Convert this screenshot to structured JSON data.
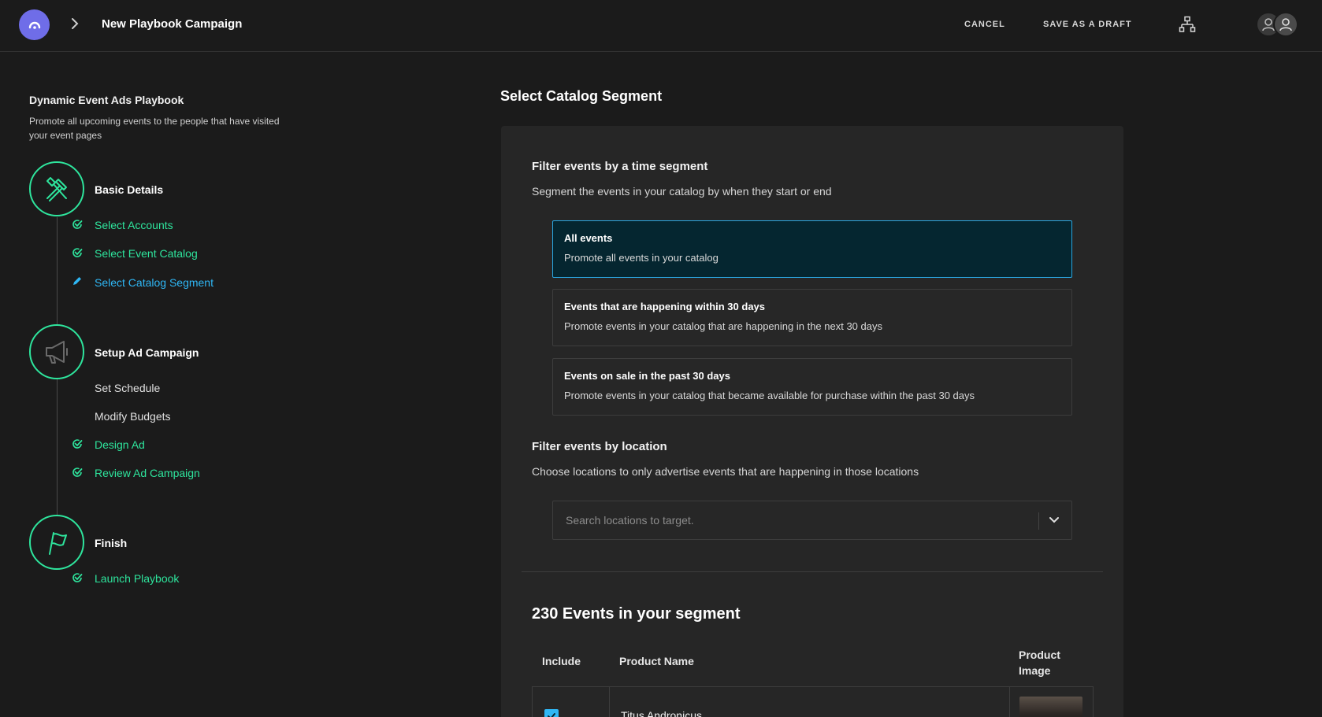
{
  "header": {
    "title": "New Playbook Campaign",
    "cancel_label": "CANCEL",
    "draft_label": "SAVE AS A DRAFT"
  },
  "sidebar": {
    "playbook_title": "Dynamic Event Ads Playbook",
    "playbook_desc": "Promote all upcoming events to the people that have visited your event pages",
    "steps": [
      {
        "title": "Basic Details",
        "items": [
          {
            "label": "Select Accounts",
            "state": "done"
          },
          {
            "label": "Select Event Catalog",
            "state": "done"
          },
          {
            "label": "Select Catalog Segment",
            "state": "active"
          }
        ]
      },
      {
        "title": "Setup Ad Campaign",
        "items": [
          {
            "label": "Set Schedule",
            "state": "todo"
          },
          {
            "label": "Modify Budgets",
            "state": "todo"
          },
          {
            "label": "Design Ad",
            "state": "done"
          },
          {
            "label": "Review Ad Campaign",
            "state": "done"
          }
        ]
      },
      {
        "title": "Finish",
        "items": [
          {
            "label": "Launch Playbook",
            "state": "done"
          }
        ]
      }
    ]
  },
  "main": {
    "section_title": "Select Catalog Segment",
    "time_filter": {
      "title": "Filter events by a time segment",
      "desc": "Segment the events in your catalog by when they start or end",
      "options": [
        {
          "title": "All events",
          "desc": "Promote all events in your catalog",
          "selected": true
        },
        {
          "title": "Events that are happening within 30 days",
          "desc": "Promote events in your catalog that are happening in the next 30 days",
          "selected": false
        },
        {
          "title": "Events on sale in the past 30 days",
          "desc": "Promote events in your catalog that became available for purchase within the past 30 days",
          "selected": false
        }
      ]
    },
    "location_filter": {
      "title": "Filter events by location",
      "desc": "Choose locations to only advertise events that are happening in those locations",
      "placeholder": "Search locations to target."
    },
    "segment": {
      "count_title": "230 Events in your segment",
      "columns": [
        "Include",
        "Product Name",
        "Product Image"
      ],
      "rows": [
        {
          "name": "Titus Andronicus",
          "included": true
        }
      ]
    }
  },
  "colors": {
    "accent_green": "#2ee59d",
    "accent_blue": "#2fb7f5",
    "logo_purple": "#6f6de8",
    "selected_bg": "#052630"
  }
}
